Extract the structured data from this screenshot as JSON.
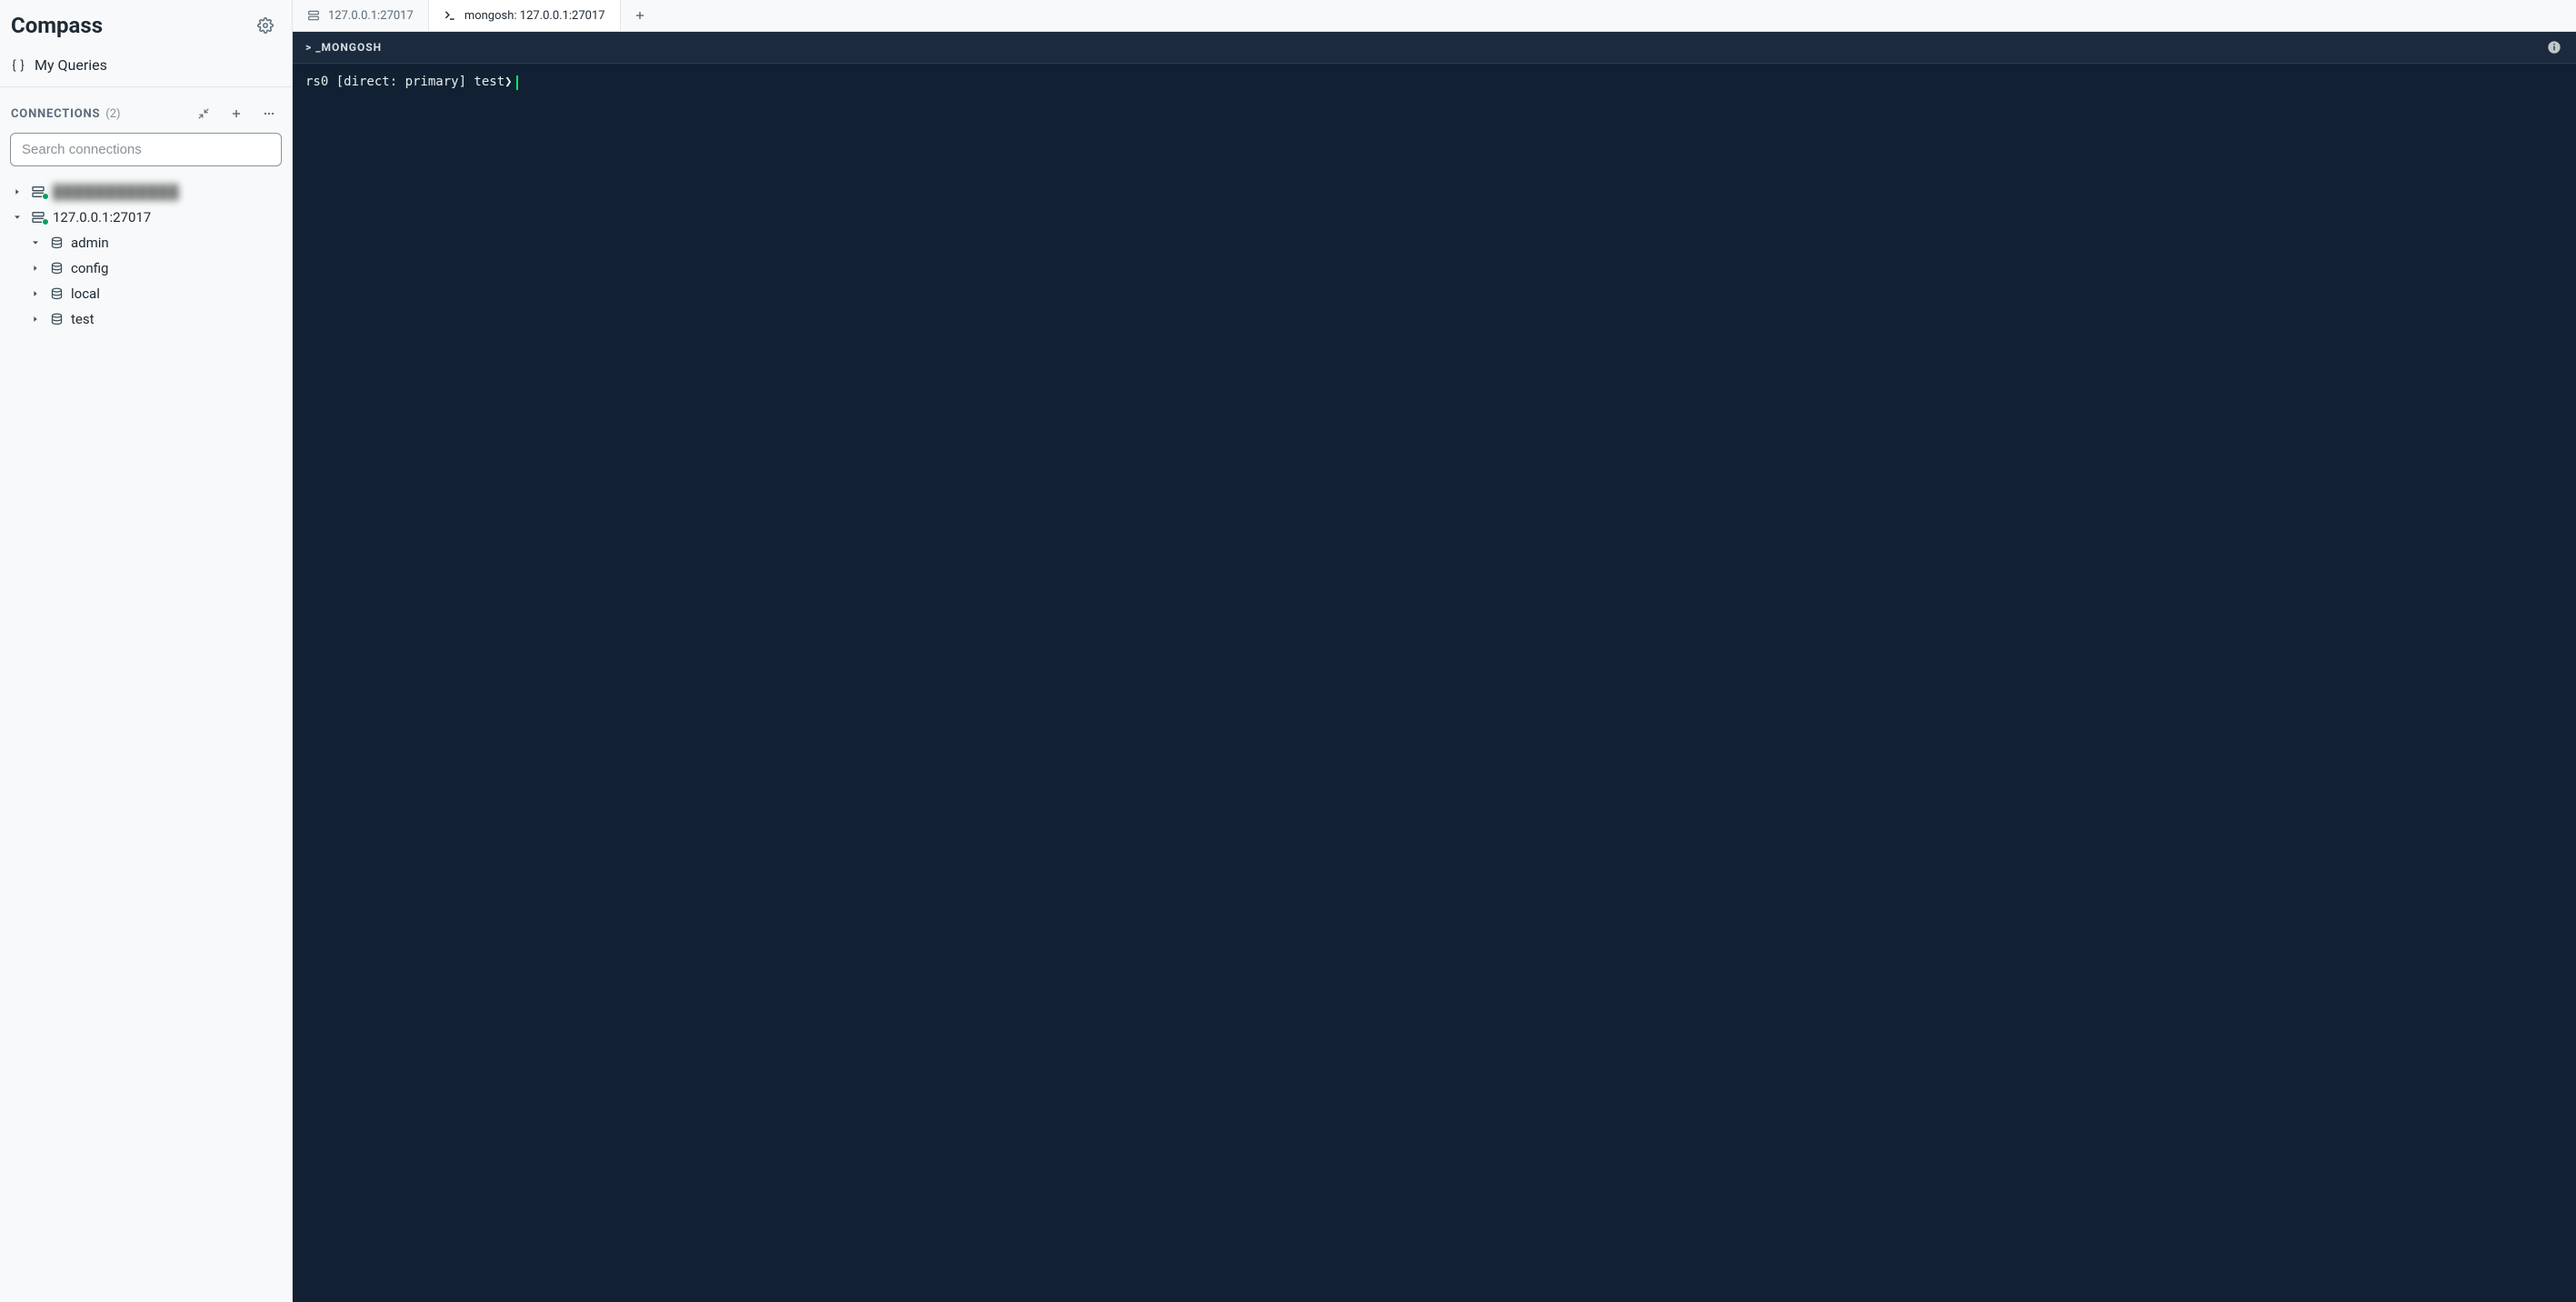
{
  "app": {
    "title": "Compass"
  },
  "sidebar": {
    "my_queries_label": "My Queries",
    "connections_label": "CONNECTIONS",
    "connections_count": "(2)",
    "search_placeholder": "Search connections",
    "connections": [
      {
        "label": "████████████",
        "expanded": false,
        "blurred": true
      },
      {
        "label": "127.0.0.1:27017",
        "expanded": true,
        "blurred": false
      }
    ],
    "databases": [
      {
        "label": "admin",
        "expanded": true
      },
      {
        "label": "config",
        "expanded": false
      },
      {
        "label": "local",
        "expanded": false
      },
      {
        "label": "test",
        "expanded": false
      }
    ]
  },
  "tabs": {
    "items": [
      {
        "label": "127.0.0.1:27017",
        "icon": "server",
        "active": false
      },
      {
        "label": "mongosh: 127.0.0.1:27017",
        "icon": "terminal",
        "active": true
      }
    ]
  },
  "mongosh": {
    "header_label": "_MONGOSH",
    "prompt": "rs0 [direct: primary] test",
    "prompt_symbol": "❯"
  }
}
